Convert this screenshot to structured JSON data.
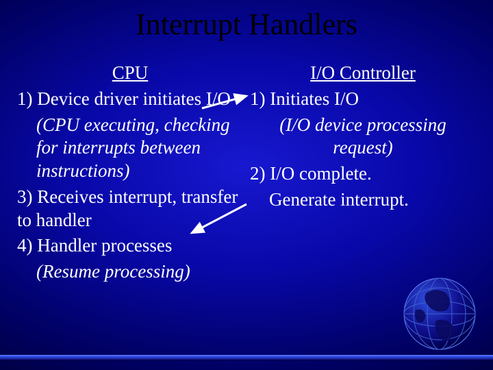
{
  "title": "Interrupt Handlers",
  "left": {
    "heading": "CPU",
    "step1": "1) Device driver initiates I/O",
    "paren1": "(CPU executing, checking for interrupts between instructions)",
    "step3": "3) Receives interrupt, transfer to handler",
    "step4": "4) Handler processes",
    "paren2": "(Resume processing)"
  },
  "right": {
    "heading": "I/O Controller",
    "step1": "1) Initiates I/O",
    "paren1": "(I/O device processing request)",
    "step2a": "2) I/O complete.",
    "step2b": "Generate interrupt."
  }
}
